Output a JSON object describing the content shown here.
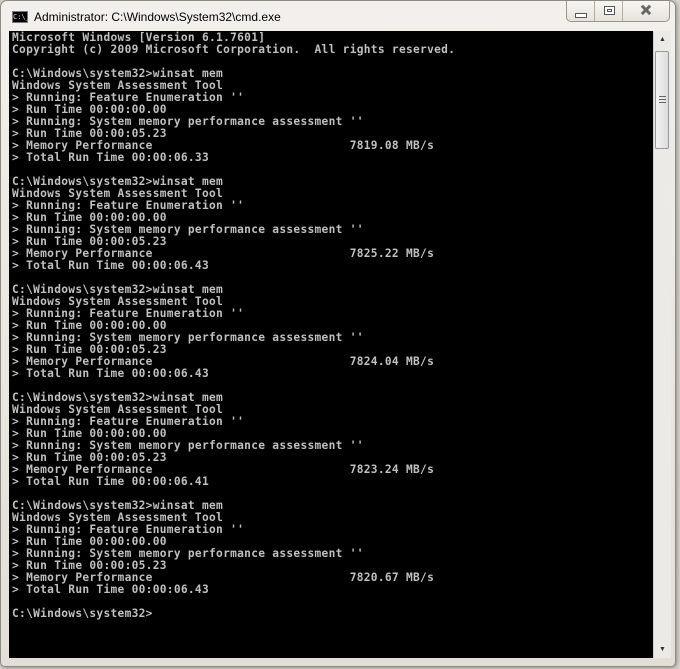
{
  "window": {
    "title": "Administrator: C:\\Windows\\System32\\cmd.exe",
    "icon": "cmd-icon",
    "controls": {
      "minimize": "minimize-icon",
      "maximize": "maximize-icon",
      "close": "close-icon"
    }
  },
  "console": {
    "header": [
      "Microsoft Windows [Version 6.1.7601]",
      "Copyright (c) 2009 Microsoft Corporation.  All rights reserved."
    ],
    "prompt": "C:\\Windows\\system32>",
    "command": "winsat mem",
    "runs": [
      {
        "memory_performance": "7819.08 MB/s",
        "total_run_time": "00:00:06.33"
      },
      {
        "memory_performance": "7825.22 MB/s",
        "total_run_time": "00:00:06.43"
      },
      {
        "memory_performance": "7824.04 MB/s",
        "total_run_time": "00:00:06.43"
      },
      {
        "memory_performance": "7823.24 MB/s",
        "total_run_time": "00:00:06.41"
      },
      {
        "memory_performance": "7820.67 MB/s",
        "total_run_time": "00:00:06.43"
      }
    ],
    "run_template": {
      "tool_name": "Windows System Assessment Tool",
      "step1": "> Running: Feature Enumeration ''",
      "step1_time": "> Run Time 00:00:00.00",
      "step2": "> Running: System memory performance assessment ''",
      "step2_time": "> Run Time 00:00:05.23",
      "perf_label": "> Memory Performance",
      "total_label": "> Total Run Time "
    },
    "text": ""
  },
  "scrollbar": {
    "up_arrow": "▲",
    "down_arrow": "▼"
  }
}
